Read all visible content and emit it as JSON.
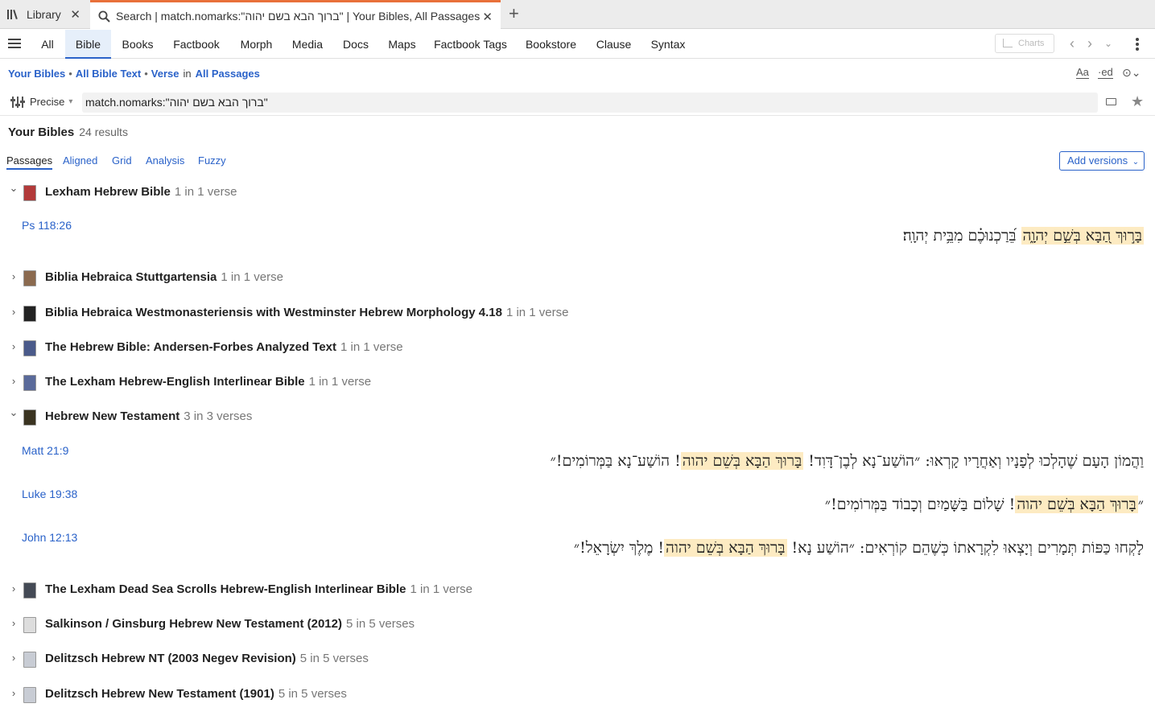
{
  "tabs": {
    "library": {
      "label": "Library",
      "icon": "library-icon"
    },
    "search": {
      "label": "Search | match.nomarks:\"ברוך הבא בשם יהוה\" | Your Bibles, All Passages",
      "icon": "search-icon"
    }
  },
  "nav": {
    "tabs": [
      "All",
      "Bible",
      "Books",
      "Factbook",
      "Morph",
      "Media",
      "Docs",
      "Maps",
      "Factbook Tags",
      "Bookstore",
      "Clause",
      "Syntax"
    ],
    "active": "Bible",
    "charts_label": "Charts"
  },
  "crumbs": {
    "your_bibles": "Your Bibles",
    "all_bible_text": "All Bible Text",
    "verse": "Verse",
    "in": "in",
    "all_passages": "All Passages",
    "sep": "•"
  },
  "tools": {
    "font": "Aa",
    "ed": "·ed"
  },
  "search": {
    "mode": "Precise",
    "query": "match.nomarks:\"ברוך הבא בשם יהוה\""
  },
  "results": {
    "title": "Your Bibles",
    "count": "24 results",
    "subtabs": [
      "Passages",
      "Aligned",
      "Grid",
      "Analysis",
      "Fuzzy"
    ],
    "add_versions": "Add versions"
  },
  "groups": [
    {
      "name": "Lexham Hebrew Bible",
      "count": "1 in 1 verse",
      "expanded": true,
      "icon_color": "#b23a3a"
    },
    {
      "name": "Biblia Hebraica Stuttgartensia",
      "count": "1 in 1 verse",
      "expanded": false,
      "icon_color": "#8b6a4f"
    },
    {
      "name": "Biblia Hebraica Westmonasteriensis with Westminster Hebrew Morphology 4.18",
      "count": "1 in 1 verse",
      "expanded": false,
      "icon_color": "#222222"
    },
    {
      "name": "The Hebrew Bible: Andersen-Forbes Analyzed Text",
      "count": "1 in 1 verse",
      "expanded": false,
      "icon_color": "#4a5a8a"
    },
    {
      "name": "The Lexham Hebrew-English Interlinear Bible",
      "count": "1 in 1 verse",
      "expanded": false,
      "icon_color": "#5a6a9a"
    },
    {
      "name": "Hebrew New Testament",
      "count": "3 in 3 verses",
      "expanded": true,
      "icon_color": "#3a3320"
    },
    {
      "name": "The Lexham Dead Sea Scrolls Hebrew-English Interlinear Bible",
      "count": "1 in 1 verse",
      "expanded": false,
      "icon_color": "#444a55"
    },
    {
      "name": "Salkinson / Ginsburg Hebrew New Testament (2012)",
      "count": "5 in 5 verses",
      "expanded": false,
      "icon_color": "#dddddd"
    },
    {
      "name": "Delitzsch Hebrew NT (2003 Negev Revision)",
      "count": "5 in 5 verses",
      "expanded": false,
      "icon_color": "#c8ccd4"
    },
    {
      "name": "Delitzsch Hebrew New Testament (1901)",
      "count": "5 in 5 verses",
      "expanded": false,
      "icon_color": "#c8ccd4"
    }
  ],
  "hits": [
    {
      "ref": "Ps 118:26",
      "match": "בָּר֣וּךְ הַ֭בָּא בְּשֵׁ֣ם יְהוָ֑ה",
      "after": " בֵּ֝רַכְנוּכֶ֗ם מִבֵּ֥ית יְהוָֽה׃",
      "before": ""
    },
    {
      "ref": "Matt 21:9",
      "before": "וַהֲמוֹן הָעָם שֶׁהָלְכוּ לְפָנָיו וְאַחֲרָיו קָרְאוּ: ״הוֹשַׁע־נָא לְבֶן־דָּוִד! ",
      "match": "בָּרוּךְ הַבָּא בְּשֵׁם יהוה",
      "after": "! הוֹשַׁע־נָא בַּמְּרוֹמִים!״"
    },
    {
      "ref": "Luke 19:38",
      "before": "״",
      "match": "בָּרוּךְ הַבָּא בְּשֵׁם יהוה",
      "after": "! שָׁלוֹם בַּשָּׁמַיִם וְכָבוֹד בַּמְּרוֹמִים!״"
    },
    {
      "ref": "John 12:13",
      "before": "לָקְחוּ כַּפּוֹת תְּמָרִים וְיָצְאוּ לִקְרָאתוֹ כְּשֶׁהֵם קוֹרְאִים: ״הוֹשַׁע נָא! ",
      "match": "בָּרוּךְ הַבָּא בְּשֵׁם יהוה",
      "after": "! מֶלֶךְ יִשְׂרָאֵל!״"
    }
  ]
}
